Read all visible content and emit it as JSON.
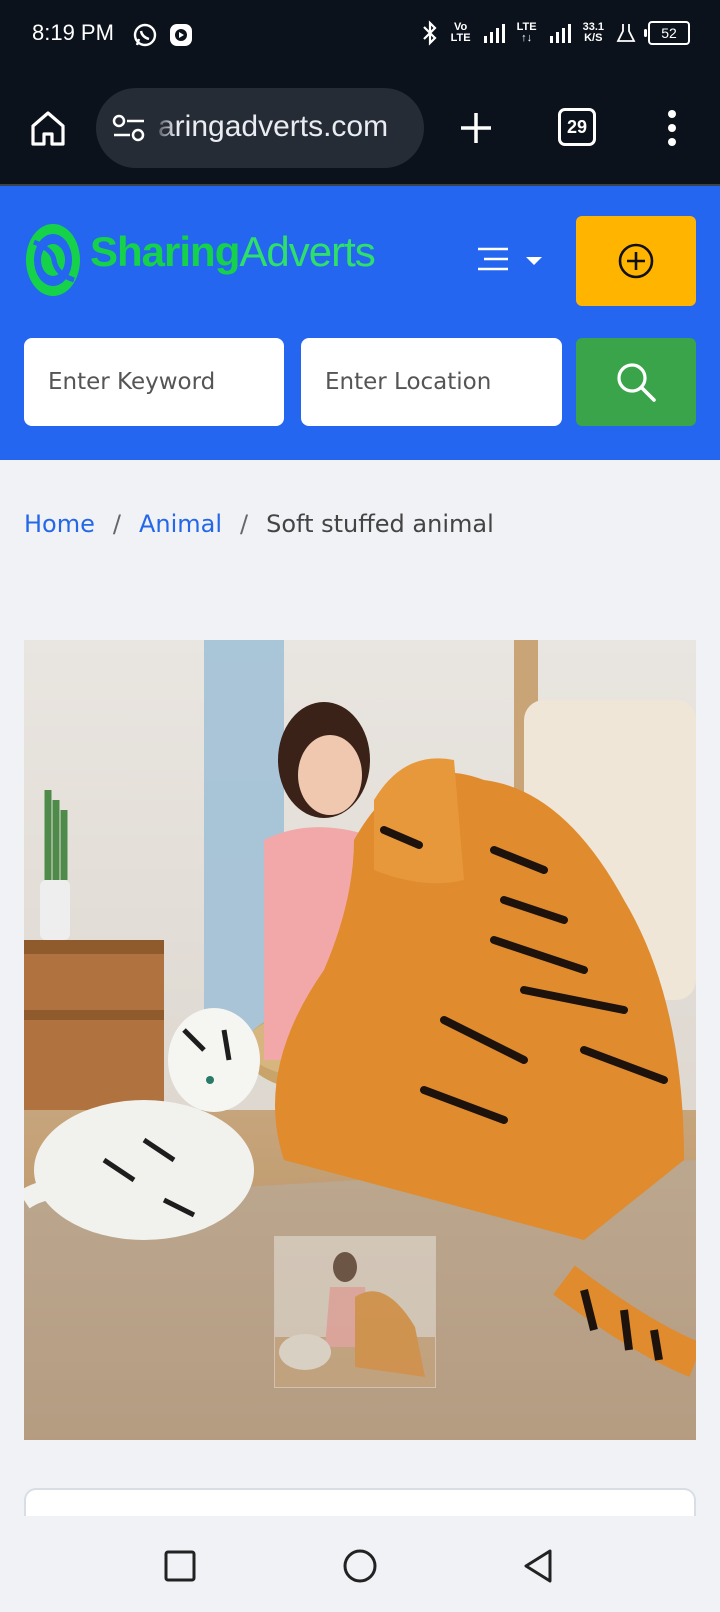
{
  "status_bar": {
    "time": "8:19 PM",
    "network_top": "Vo",
    "network_bottom": "LTE",
    "lte_label": "LTE",
    "speed_value": "33.1",
    "speed_unit": "K/S",
    "battery": "52"
  },
  "browser": {
    "url": "aringadverts.com",
    "tab_count": "29"
  },
  "site": {
    "logo_part1": "Sharing",
    "logo_part2": "Adverts",
    "accent_blue": "#2466f0",
    "post_button_color": "#ffb400",
    "search_button_color": "#3aa44a"
  },
  "search": {
    "keyword_placeholder": "Enter Keyword",
    "location_placeholder": "Enter Location"
  },
  "breadcrumb": {
    "home": "Home",
    "category": "Animal",
    "current": "Soft stuffed animal",
    "separator": "/"
  }
}
